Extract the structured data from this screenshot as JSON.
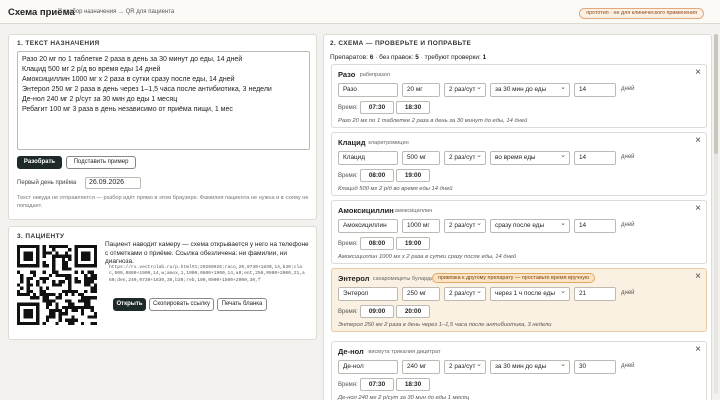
{
  "header": {
    "title": "Схема приёма",
    "subtitle": "разбор назначения → QR для пациента",
    "badge": "прототип · не для клинического применения"
  },
  "section1": {
    "title": "1. ТЕКСТ НАЗНАЧЕНИЯ",
    "prescription_text": "Разо 20 мг по 1 таблетке 2 раза в день за 30 минут до еды, 14 дней\nКлацид 500 мг 2 р/д во время еды 14 дней\nАмоксициллин 1000 мг х 2 раза в сутки сразу после еды, 14 дней\nЭнтерол 250 мг 2 раза в день через 1–1,5 часа после антибиотика, 3 недели\nДе-нол 240 мг 2 р/сут за 30 мин до еды 1 месяц\nРебагит 100 мг 3 раза в день независимо от приёма пищи, 1 мес",
    "parse_button": "Разобрать",
    "example_button": "Подставить пример",
    "first_day_label": "Первый день приёма",
    "first_day_value": "26.09.2026",
    "note": "Текст никуда не отправляется — разбор идёт прямо в этом браузере. Фамилия пациента не нужна и в схему не попадает."
  },
  "section3": {
    "title": "3. ПАЦИЕНТУ",
    "description": "Пациент наводит камеру — схема открывается у него на телефоне с отметками о приёме. Ссылка обезличена: ни фамилии, ни диагноза.",
    "url": "https://rx.vectrolab.ru/p.html#1;20260926;raco,20,0730+1830,14,b30;clac,500,0800+1900,14,w;amox,1,1000,0800+1900,14,a0;ent,250,0900+2000,21,a60;den,240,0730+1830,30,b30;reb,100,0900+1500+2000,30,f",
    "open_button": "Открыть",
    "copy_button": "Скопировать ссылку",
    "print_button": "Печать бланка"
  },
  "section2": {
    "title": "2. СХЕМА — ПРОВЕРЬТЕ И ПОПРАВЬТЕ",
    "stats": {
      "drugs_label": "Препаратов:",
      "drugs_count": "6",
      "no_edits_label": "· без правок:",
      "no_edits_count": "5",
      "needs_check_label": "· требуют проверки:",
      "needs_check_count": "1"
    },
    "time_label": "Время:",
    "days_unit": "дней",
    "drugs": [
      {
        "name": "Разо",
        "generic": "рабепразол",
        "form_name": "Разо",
        "dose": "20 мг",
        "freq": "2 раз/сут",
        "timing": "за 30 мин до еды",
        "days": "14",
        "times": [
          "07:30",
          "18:30"
        ],
        "preview": "Разо 20 мг по 1 таблетке 2 раза в день за 30 минут до еды, 14 дней",
        "badge": ""
      },
      {
        "name": "Клацид",
        "generic": "кларитромицин",
        "form_name": "Клацид",
        "dose": "500 мг",
        "freq": "2 раз/сут",
        "timing": "во время еды",
        "days": "14",
        "times": [
          "08:00",
          "19:00"
        ],
        "preview": "Клацид 500 мг 2 р/д во время еды 14 дней",
        "badge": ""
      },
      {
        "name": "Амоксициллин",
        "generic": "амоксициллин",
        "form_name": "Амоксициллин",
        "dose": "1000 мг",
        "freq": "2 раз/сут",
        "timing": "сразу после еды",
        "days": "14",
        "times": [
          "08:00",
          "19:00"
        ],
        "preview": "Амоксициллин 1000 мг х 2 раза в сутки сразу после еды, 14 дней",
        "badge": ""
      },
      {
        "name": "Энтерол",
        "generic": "сахаромицеты буларди",
        "form_name": "Энтерол",
        "dose": "250 мг",
        "freq": "2 раз/сут",
        "timing": "через 1 ч после еды",
        "days": "21",
        "times": [
          "09:00",
          "20:00"
        ],
        "preview": "Энтерол 250 мг 2 раза в день через 1–1,5 часа после антибиотика, 3 недели",
        "badge": "привязка к другому препарату — проставьте время вручную"
      },
      {
        "name": "Де-нол",
        "generic": "висмута трикалия дицитрат",
        "form_name": "Де-нол",
        "dose": "240 мг",
        "freq": "2 раз/сут",
        "timing": "за 30 мин до еды",
        "days": "30",
        "times": [
          "07:30",
          "18:30"
        ],
        "preview": "Де-нол 240 мг 2 р/сут за 30 мин до еды 1 месяц",
        "badge": ""
      }
    ]
  },
  "colors": {
    "accent_dark": "#1e2a2a",
    "warning_bg": "#fbf1e2",
    "badge_bg": "#fdf0e4"
  }
}
